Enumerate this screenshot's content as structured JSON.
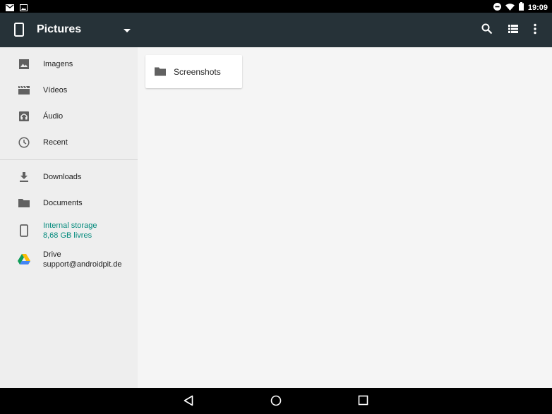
{
  "status_bar": {
    "time": "19:09",
    "icons": [
      "gmail-icon",
      "image-notification-icon",
      "do-not-disturb-icon",
      "wifi-icon",
      "battery-icon"
    ]
  },
  "app_bar": {
    "title": "Pictures",
    "icons": [
      "device-icon",
      "dropdown-icon",
      "search-icon",
      "list-view-icon",
      "overflow-menu-icon"
    ],
    "color": "#263238"
  },
  "sidebar": {
    "items": [
      {
        "label": "Imagens",
        "icon": "image-icon"
      },
      {
        "label": "Vídeos",
        "icon": "video-icon"
      },
      {
        "label": "Áudio",
        "icon": "audio-icon"
      },
      {
        "label": "Recent",
        "icon": "clock-icon"
      },
      {
        "label": "Downloads",
        "icon": "download-icon"
      },
      {
        "label": "Documents",
        "icon": "folder-icon"
      },
      {
        "label": "Internal storage",
        "sublabel": "8,68 GB livres",
        "icon": "phone-icon",
        "active": true
      },
      {
        "label": "Drive",
        "sublabel": "support@androidpit.de",
        "icon": "drive-icon"
      }
    ],
    "active_color": "#00897b"
  },
  "main": {
    "folders": [
      {
        "label": "Screenshots",
        "icon": "folder-icon"
      }
    ]
  },
  "nav_bar": {
    "buttons": [
      "back-icon",
      "home-icon",
      "recents-icon"
    ]
  }
}
